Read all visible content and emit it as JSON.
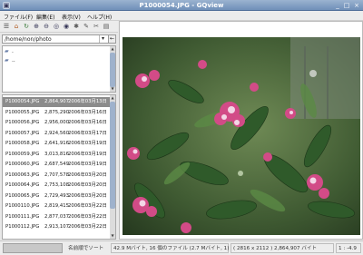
{
  "window": {
    "title": "P1000054.JPG - GQview"
  },
  "menubar": {
    "items": [
      "ファイル(F)",
      "編集(E)",
      "表示(V)",
      "ヘルプ(H)"
    ]
  },
  "path": {
    "value": "/home/non/photo"
  },
  "dirs": [
    {
      "icon": "folder-icon",
      "name": "."
    },
    {
      "icon": "folder-up-icon",
      "name": ".."
    }
  ],
  "files": [
    {
      "name": "P1000054.JPG",
      "size": "2,864,907",
      "date": "2006年03月13日",
      "selected": true
    },
    {
      "name": "P1000055.JPG",
      "size": "2,875,290",
      "date": "2006年03月16日"
    },
    {
      "name": "P1000056.JPG",
      "size": "2,956,000",
      "date": "2006年03月16日"
    },
    {
      "name": "P1000057.JPG",
      "size": "2,924,560",
      "date": "2006年03月17日"
    },
    {
      "name": "P1000058.JPG",
      "size": "2,641,916",
      "date": "2006年03月19日"
    },
    {
      "name": "P1000059.JPG",
      "size": "3,013,816",
      "date": "2006年03月19日"
    },
    {
      "name": "P1000060.JPG",
      "size": "2,687,549",
      "date": "2006年03月19日"
    },
    {
      "name": "P1000063.JPG",
      "size": "2,707,578",
      "date": "2006年03月20日"
    },
    {
      "name": "P1000064.JPG",
      "size": "2,753,108",
      "date": "2006年03月20日"
    },
    {
      "name": "P1000065.JPG",
      "size": "2,729,493",
      "date": "2006年03月20日"
    },
    {
      "name": "P1000110.JPG",
      "size": "2,819,415",
      "date": "2006年03月22日"
    },
    {
      "name": "P1000111.JPG",
      "size": "2,877,037",
      "date": "2006年03月22日"
    },
    {
      "name": "P1000112.JPG",
      "size": "2,913,107",
      "date": "2006年03月22日"
    }
  ],
  "statusbar": {
    "sort": "名前順でソート",
    "summary": "42.9 Mバイト, 16 個のファイル (2.7 Mバイト, 1)",
    "image_info": "( 2816 x 2112 ) 2,864,907 バイト",
    "zoom": "1 : -4.9"
  },
  "colors": {
    "selection": "#8b8b8b",
    "titlebar": "#6f8fb8"
  }
}
